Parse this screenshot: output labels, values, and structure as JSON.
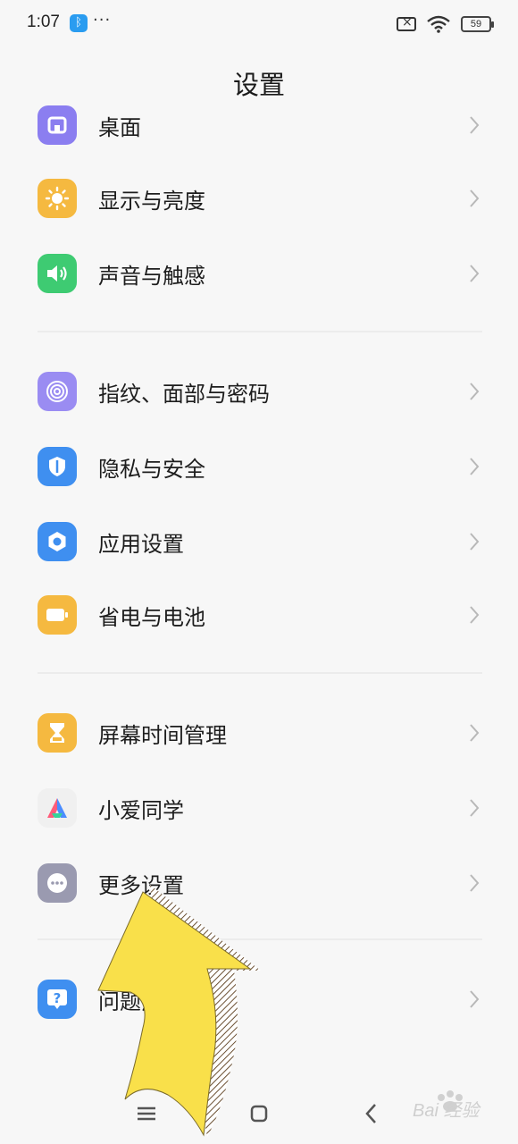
{
  "status_bar": {
    "time": "1:07",
    "dots": "···",
    "battery": "59"
  },
  "header": {
    "title": "设置"
  },
  "groups": [
    {
      "items": [
        {
          "label": "桌面",
          "icon": "desktop-icon",
          "color": "#8b7ef0"
        },
        {
          "label": "显示与亮度",
          "icon": "sun-brightness-icon",
          "color": "#f5b940"
        },
        {
          "label": "声音与触感",
          "icon": "speaker-icon",
          "color": "#3ecb72"
        }
      ]
    },
    {
      "items": [
        {
          "label": "指纹、面部与密码",
          "icon": "fingerprint-icon",
          "color": "#9a8cf2"
        },
        {
          "label": "隐私与安全",
          "icon": "privacy-shield-icon",
          "color": "#3f8ff0"
        },
        {
          "label": "应用设置",
          "icon": "app-settings-gear-icon",
          "color": "#3f8ff0"
        },
        {
          "label": "省电与电池",
          "icon": "battery-icon",
          "color": "#f5b940"
        }
      ]
    },
    {
      "items": [
        {
          "label": "屏幕时间管理",
          "icon": "hourglass-icon",
          "color": "#f5b940"
        },
        {
          "label": "小爱同学",
          "icon": "xiaoai-assistant-icon",
          "color": "#f0f0f0"
        },
        {
          "label": "更多设置",
          "icon": "more-dots-icon",
          "color": "#9a9ab0"
        }
      ]
    },
    {
      "items": [
        {
          "label": "问题反馈",
          "icon": "question-icon",
          "color": "#3f8ff0"
        }
      ]
    }
  ],
  "watermark": {
    "text": "Bai 经验"
  },
  "accent_colors": {
    "arrow": "#f9e04a"
  }
}
